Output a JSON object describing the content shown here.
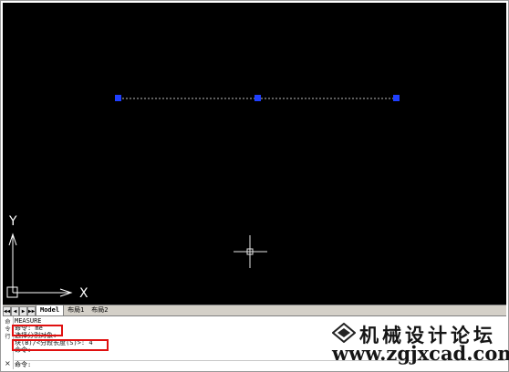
{
  "ucs": {
    "y_label": "Y",
    "x_label": "X"
  },
  "tabs": {
    "nav": [
      "◀◀",
      "◀",
      "▶",
      "▶▶"
    ],
    "items": [
      "Model",
      "布局1",
      "布局2"
    ]
  },
  "command": {
    "side_label": "命令行",
    "close_label": "×",
    "history": [
      "MEASURE",
      "命令: me",
      "选择分割对象:",
      "块(B)/<分段长度(S)>: 4",
      "命令:"
    ],
    "prompt": "命令:"
  },
  "watermark": {
    "title": "机械设计论坛",
    "url": "www.zgjxcad.com"
  },
  "colors": {
    "canvas": "#000000",
    "grip": "#1f3fff",
    "highlight": "#e01010"
  }
}
